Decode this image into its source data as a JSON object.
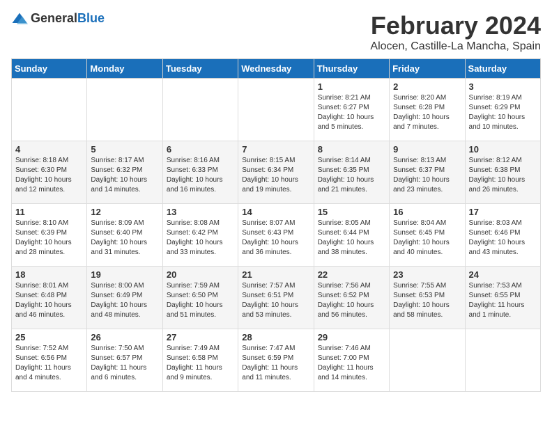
{
  "header": {
    "logo_general": "General",
    "logo_blue": "Blue",
    "title": "February 2024",
    "subtitle": "Alocen, Castille-La Mancha, Spain"
  },
  "calendar": {
    "days_of_week": [
      "Sunday",
      "Monday",
      "Tuesday",
      "Wednesday",
      "Thursday",
      "Friday",
      "Saturday"
    ],
    "weeks": [
      [
        {
          "day": "",
          "info": ""
        },
        {
          "day": "",
          "info": ""
        },
        {
          "day": "",
          "info": ""
        },
        {
          "day": "",
          "info": ""
        },
        {
          "day": "1",
          "info": "Sunrise: 8:21 AM\nSunset: 6:27 PM\nDaylight: 10 hours\nand 5 minutes."
        },
        {
          "day": "2",
          "info": "Sunrise: 8:20 AM\nSunset: 6:28 PM\nDaylight: 10 hours\nand 7 minutes."
        },
        {
          "day": "3",
          "info": "Sunrise: 8:19 AM\nSunset: 6:29 PM\nDaylight: 10 hours\nand 10 minutes."
        }
      ],
      [
        {
          "day": "4",
          "info": "Sunrise: 8:18 AM\nSunset: 6:30 PM\nDaylight: 10 hours\nand 12 minutes."
        },
        {
          "day": "5",
          "info": "Sunrise: 8:17 AM\nSunset: 6:32 PM\nDaylight: 10 hours\nand 14 minutes."
        },
        {
          "day": "6",
          "info": "Sunrise: 8:16 AM\nSunset: 6:33 PM\nDaylight: 10 hours\nand 16 minutes."
        },
        {
          "day": "7",
          "info": "Sunrise: 8:15 AM\nSunset: 6:34 PM\nDaylight: 10 hours\nand 19 minutes."
        },
        {
          "day": "8",
          "info": "Sunrise: 8:14 AM\nSunset: 6:35 PM\nDaylight: 10 hours\nand 21 minutes."
        },
        {
          "day": "9",
          "info": "Sunrise: 8:13 AM\nSunset: 6:37 PM\nDaylight: 10 hours\nand 23 minutes."
        },
        {
          "day": "10",
          "info": "Sunrise: 8:12 AM\nSunset: 6:38 PM\nDaylight: 10 hours\nand 26 minutes."
        }
      ],
      [
        {
          "day": "11",
          "info": "Sunrise: 8:10 AM\nSunset: 6:39 PM\nDaylight: 10 hours\nand 28 minutes."
        },
        {
          "day": "12",
          "info": "Sunrise: 8:09 AM\nSunset: 6:40 PM\nDaylight: 10 hours\nand 31 minutes."
        },
        {
          "day": "13",
          "info": "Sunrise: 8:08 AM\nSunset: 6:42 PM\nDaylight: 10 hours\nand 33 minutes."
        },
        {
          "day": "14",
          "info": "Sunrise: 8:07 AM\nSunset: 6:43 PM\nDaylight: 10 hours\nand 36 minutes."
        },
        {
          "day": "15",
          "info": "Sunrise: 8:05 AM\nSunset: 6:44 PM\nDaylight: 10 hours\nand 38 minutes."
        },
        {
          "day": "16",
          "info": "Sunrise: 8:04 AM\nSunset: 6:45 PM\nDaylight: 10 hours\nand 40 minutes."
        },
        {
          "day": "17",
          "info": "Sunrise: 8:03 AM\nSunset: 6:46 PM\nDaylight: 10 hours\nand 43 minutes."
        }
      ],
      [
        {
          "day": "18",
          "info": "Sunrise: 8:01 AM\nSunset: 6:48 PM\nDaylight: 10 hours\nand 46 minutes."
        },
        {
          "day": "19",
          "info": "Sunrise: 8:00 AM\nSunset: 6:49 PM\nDaylight: 10 hours\nand 48 minutes."
        },
        {
          "day": "20",
          "info": "Sunrise: 7:59 AM\nSunset: 6:50 PM\nDaylight: 10 hours\nand 51 minutes."
        },
        {
          "day": "21",
          "info": "Sunrise: 7:57 AM\nSunset: 6:51 PM\nDaylight: 10 hours\nand 53 minutes."
        },
        {
          "day": "22",
          "info": "Sunrise: 7:56 AM\nSunset: 6:52 PM\nDaylight: 10 hours\nand 56 minutes."
        },
        {
          "day": "23",
          "info": "Sunrise: 7:55 AM\nSunset: 6:53 PM\nDaylight: 10 hours\nand 58 minutes."
        },
        {
          "day": "24",
          "info": "Sunrise: 7:53 AM\nSunset: 6:55 PM\nDaylight: 11 hours\nand 1 minute."
        }
      ],
      [
        {
          "day": "25",
          "info": "Sunrise: 7:52 AM\nSunset: 6:56 PM\nDaylight: 11 hours\nand 4 minutes."
        },
        {
          "day": "26",
          "info": "Sunrise: 7:50 AM\nSunset: 6:57 PM\nDaylight: 11 hours\nand 6 minutes."
        },
        {
          "day": "27",
          "info": "Sunrise: 7:49 AM\nSunset: 6:58 PM\nDaylight: 11 hours\nand 9 minutes."
        },
        {
          "day": "28",
          "info": "Sunrise: 7:47 AM\nSunset: 6:59 PM\nDaylight: 11 hours\nand 11 minutes."
        },
        {
          "day": "29",
          "info": "Sunrise: 7:46 AM\nSunset: 7:00 PM\nDaylight: 11 hours\nand 14 minutes."
        },
        {
          "day": "",
          "info": ""
        },
        {
          "day": "",
          "info": ""
        }
      ]
    ]
  }
}
